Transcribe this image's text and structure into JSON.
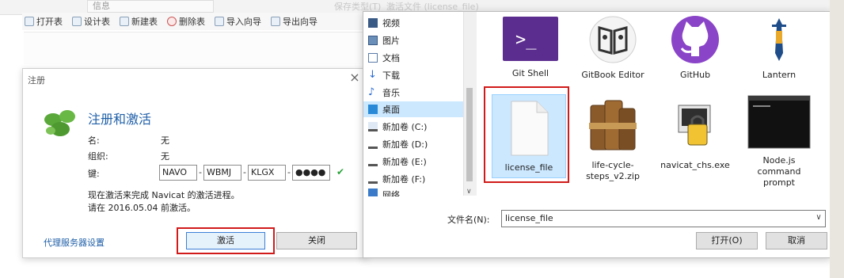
{
  "background": {
    "info_label": "信息",
    "toolbar": [
      {
        "label": "打开表",
        "icon": "open-table-icon"
      },
      {
        "label": "设计表",
        "icon": "design-table-icon"
      },
      {
        "label": "新建表",
        "icon": "new-table-icon"
      },
      {
        "label": "删除表",
        "icon": "delete-table-icon"
      },
      {
        "label": "导入向导",
        "icon": "import-wizard-icon"
      },
      {
        "label": "导出向导",
        "icon": "export-wizard-icon"
      }
    ]
  },
  "register_dialog": {
    "title": "注册",
    "heading": "注册和激活",
    "name_label": "名:",
    "name_value": "无",
    "org_label": "组织:",
    "org_value": "无",
    "key_label": "键:",
    "key_parts": [
      "NAVO",
      "WBMJ",
      "KLGX",
      "●●●●"
    ],
    "note_line1": "现在激活来完成 Navicat 的激活进程。",
    "note_line2": "请在 2016.05.04 前激活。",
    "proxy_link": "代理服务器设置",
    "activate_button": "激活",
    "close_button": "关闭"
  },
  "file_dialog": {
    "top_strip_left": "保存类型(T)",
    "top_strip_field": "激活文件 (license_file)",
    "nav_items": [
      {
        "label": "视频",
        "icon": "video-folder-icon"
      },
      {
        "label": "图片",
        "icon": "pictures-folder-icon"
      },
      {
        "label": "文档",
        "icon": "documents-folder-icon"
      },
      {
        "label": "下载",
        "icon": "downloads-folder-icon"
      },
      {
        "label": "音乐",
        "icon": "music-folder-icon"
      },
      {
        "label": "桌面",
        "icon": "desktop-folder-icon"
      },
      {
        "label": "新加卷 (C:)",
        "icon": "drive-icon"
      },
      {
        "label": "新加卷 (D:)",
        "icon": "drive-icon"
      },
      {
        "label": "新加卷 (E:)",
        "icon": "drive-icon"
      },
      {
        "label": "新加卷 (F:)",
        "icon": "drive-icon"
      },
      {
        "label": "网络",
        "icon": "network-icon"
      }
    ],
    "files": [
      {
        "name": "Git Shell"
      },
      {
        "name": "GitBook Editor"
      },
      {
        "name": "GitHub"
      },
      {
        "name": "Lantern"
      },
      {
        "name": "license_file"
      },
      {
        "name": "life-cycle-steps_v2.zip"
      },
      {
        "name": "navicat_chs.exe"
      },
      {
        "name": "Node.js command prompt"
      }
    ],
    "filename_label": "文件名(N):",
    "filename_value": "license_file",
    "open_button": "打开(O)",
    "cancel_button": "取消"
  },
  "colors": {
    "accent": "#1f5fa8",
    "highlight": "#d11a1a",
    "selection": "#cce8ff"
  }
}
